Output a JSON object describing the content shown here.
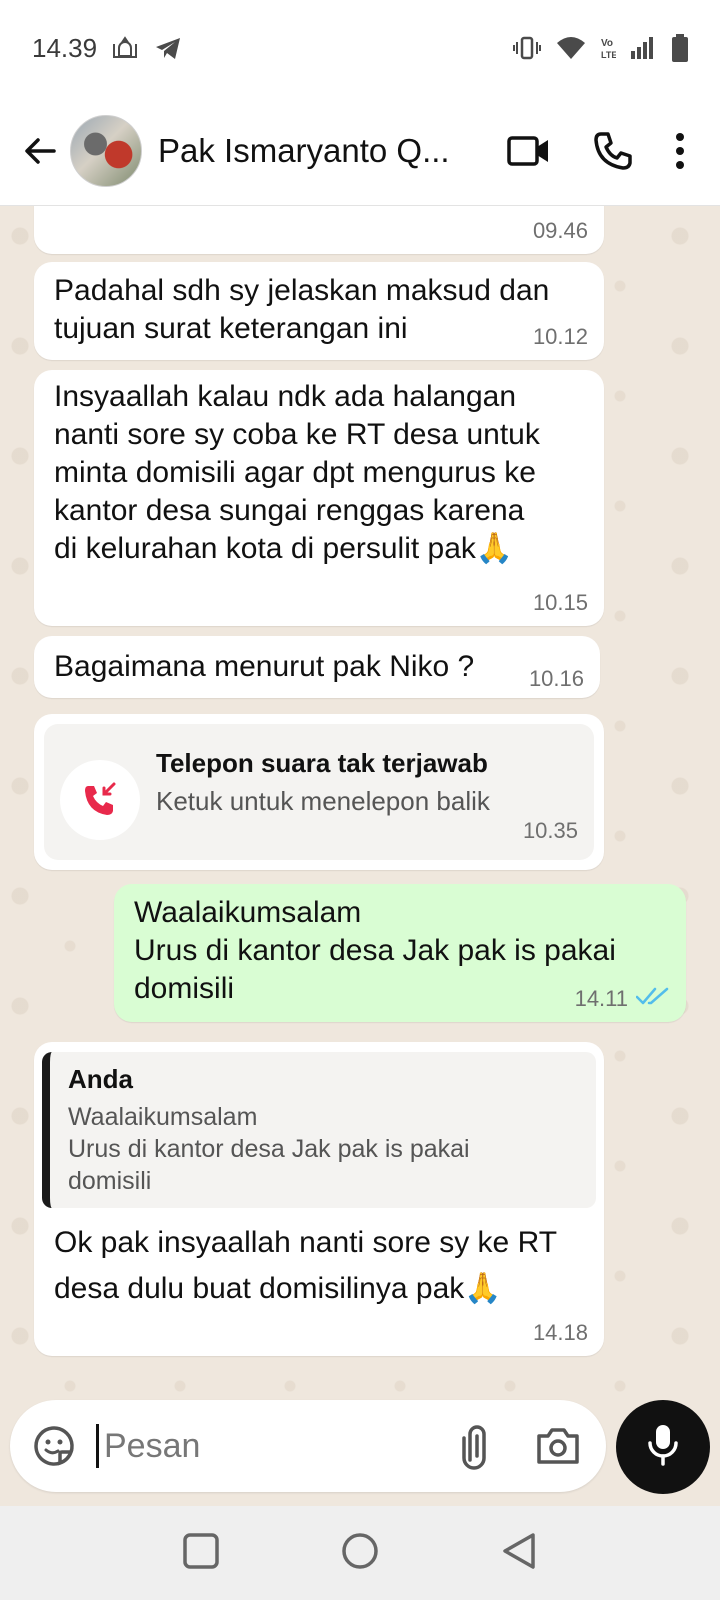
{
  "status_bar": {
    "time": "14.39",
    "icons": [
      "mosque-icon",
      "telegram-icon",
      "vibrate-icon",
      "wifi-icon",
      "volte-icon",
      "signal-icon",
      "battery-icon"
    ],
    "volte_label": "Vo\nLTE"
  },
  "header": {
    "contact_name": "Pak Ismaryanto Q...",
    "icons": [
      "back-arrow-icon",
      "avatar",
      "video-call-icon",
      "phone-icon",
      "more-options-icon"
    ]
  },
  "messages": [
    {
      "direction": "in",
      "text": "",
      "time": "09.46"
    },
    {
      "direction": "in",
      "text": "Padahal sdh sy jelaskan maksud dan\ntujuan surat keterangan ini",
      "time": "10.12"
    },
    {
      "direction": "in",
      "text": "Insyaallah kalau ndk ada halangan\nnanti sore sy coba ke RT desa untuk\nminta domisili agar dpt mengurus ke\nkantor desa sungai renggas karena\ndi kelurahan kota di persulit pak🙏",
      "time": "10.15"
    },
    {
      "direction": "in",
      "text": "Bagaimana menurut pak Niko ?",
      "time": "10.16"
    },
    {
      "direction": "in",
      "type": "missed_call",
      "title": "Telepon suara tak terjawab",
      "subtitle": "Ketuk untuk menelepon balik",
      "time": "10.35"
    },
    {
      "direction": "out",
      "text": "Waalaikumsalam\nUrus di kantor desa Jak pak is pakai\ndomisili",
      "time": "14.11",
      "status": "read"
    },
    {
      "direction": "in",
      "quote": {
        "author": "Anda",
        "text": "Waalaikumsalam\nUrus di kantor desa Jak pak is pakai\ndomisili"
      },
      "text": "Ok pak insyaallah nanti sore sy ke RT\ndesa dulu buat domisilinya pak🙏",
      "time": "14.18"
    }
  ],
  "input": {
    "placeholder": "Pesan",
    "value": ""
  },
  "colors": {
    "chat_bg": "#efe7dd",
    "incoming_bubble": "#ffffff",
    "outgoing_bubble": "#d9fdd3",
    "read_tick": "#53bdeb",
    "missed_call": "#e8294b",
    "mic_button": "#111111"
  }
}
